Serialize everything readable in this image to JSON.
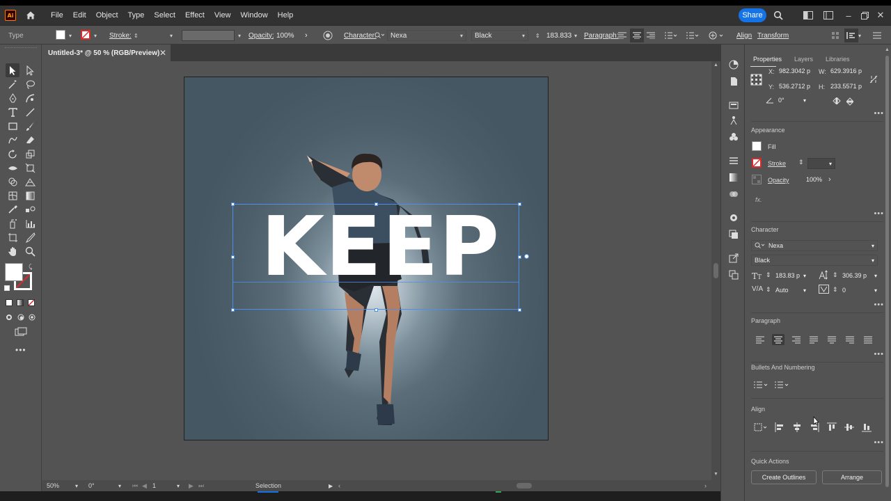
{
  "app": {
    "logo_text": "Ai"
  },
  "menu": [
    "File",
    "Edit",
    "Object",
    "Type",
    "Select",
    "Effect",
    "View",
    "Window",
    "Help"
  ],
  "share_label": "Share",
  "control_bar": {
    "tool_name": "Type",
    "stroke_label": "Stroke:",
    "opacity_label": "Opacity:",
    "opacity_value": "100%",
    "character_label": "Character:",
    "font_family": "Nexa",
    "font_style": "Black",
    "font_size": "183.833",
    "paragraph_label": "Paragraph:",
    "align_label": "Align",
    "transform_label": "Transform"
  },
  "document_tab": {
    "title": "Untitled-3* @ 50 % (RGB/Preview)"
  },
  "artboard": {
    "headline": "KEEP",
    "background_color": "#4c5e6a"
  },
  "status_bar": {
    "zoom": "50%",
    "rotation": "0°",
    "artboard_number": "1",
    "mode": "Selection"
  },
  "panel": {
    "tabs": [
      "Properties",
      "Layers",
      "Libraries"
    ],
    "transform": {
      "x_label": "X:",
      "x": "982.3042 p",
      "y_label": "Y:",
      "y": "536.2712 p",
      "w_label": "W:",
      "w": "629.3916 p",
      "h_label": "H:",
      "h": "233.5571 p",
      "angle": "0°"
    },
    "appearance": {
      "title": "Appearance",
      "fill_label": "Fill",
      "stroke_label": "Stroke",
      "opacity_label": "Opacity",
      "opacity_value": "100%",
      "fx_label": "fx."
    },
    "character": {
      "title": "Character",
      "font_family": "Nexa",
      "font_style": "Black",
      "font_size": "183.83 p",
      "leading": "306.39 p",
      "kerning": "Auto",
      "tracking": "0"
    },
    "paragraph": {
      "title": "Paragraph"
    },
    "bullets": {
      "title": "Bullets And Numbering"
    },
    "align": {
      "title": "Align"
    },
    "quick_actions": {
      "title": "Quick Actions",
      "create_outlines": "Create Outlines",
      "arrange": "Arrange"
    }
  },
  "colors": {
    "accent": "#1473e6",
    "selection": "#4d8ee8",
    "stroke_none": "#d92b2b"
  }
}
